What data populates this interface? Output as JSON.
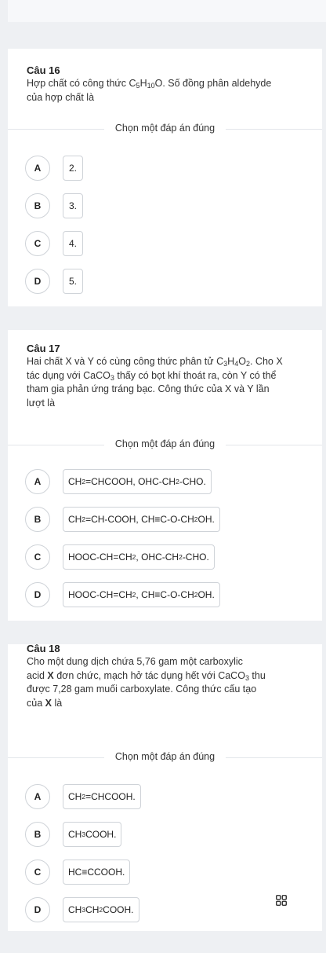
{
  "divider_label": "Chọn một đáp án đúng",
  "questions": [
    {
      "title": "Câu 16",
      "text_html": "Hợp chất có công thức C<sub>5</sub>H<sub>10</sub>O. Số đồng phân aldehyde<br>của hợp chất là",
      "options": [
        {
          "letter": "A",
          "html": "2."
        },
        {
          "letter": "B",
          "html": "3."
        },
        {
          "letter": "C",
          "html": "4."
        },
        {
          "letter": "D",
          "html": "5."
        }
      ]
    },
    {
      "title": "Câu 17",
      "text_html": "Hai chất X và Y có cùng công thức phân tử C<sub>3</sub>H<sub>4</sub>O<sub>2</sub>. Cho X<br>tác dụng với CaCO<sub>3</sub> thấy có bọt khí thoát ra, còn Y có thể<br>tham gia phản ứng tráng bạc. Công thức của X và Y lần<br>lượt là",
      "options": [
        {
          "letter": "A",
          "html": "CH<sub>2</sub>=CHCOOH, OHC-CH<sub>2</sub>-CHO."
        },
        {
          "letter": "B",
          "html": "CH<sub>2</sub>=CH-COOH, CH≡C-O-CH<sub>2</sub>OH."
        },
        {
          "letter": "C",
          "html": "HOOC-CH=CH<sub>2</sub>, OHC-CH<sub>2</sub>-CHO."
        },
        {
          "letter": "D",
          "html": "HOOC-CH=CH<sub>2</sub>, CH≡C-O-CH<sub>2</sub>OH."
        }
      ]
    },
    {
      "title": "Câu 18",
      "text_html": "Cho một dung dịch chứa 5,76 gam một carboxylic<br>acid <b>X</b> đơn chức, mạch hở tác dụng hết với CaCO<sub>3</sub> thu<br>được 7,28 gam muối carboxylate. Công thức cấu tạo<br>của <b>X</b> là",
      "options": [
        {
          "letter": "A",
          "html": "CH<sub>2</sub>=CHCOOH."
        },
        {
          "letter": "B",
          "html": "CH<sub>3</sub>COOH."
        },
        {
          "letter": "C",
          "html": "HC≡CCOOH."
        },
        {
          "letter": "D",
          "html": "CH<sub>3</sub>CH<sub>2</sub>COOH."
        }
      ]
    }
  ],
  "icons": {
    "floating_button": "grid-icon"
  }
}
